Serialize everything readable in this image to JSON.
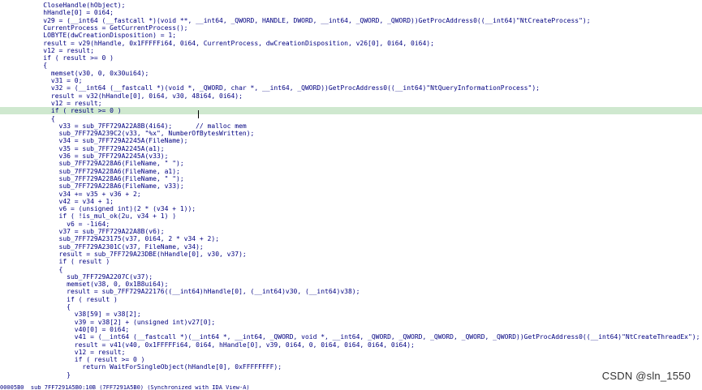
{
  "window": {
    "watermark": "CSDN @sln_1550",
    "status_text": "00005B0  sub_7FF7291A5B0:10B (7FF7291A5B0) (Synchronized with IDA View-A)"
  },
  "colors": {
    "code_text": "#000080",
    "highlight_line": "#cfe8cf",
    "comment": "#008000",
    "search_mark": "#ffff66",
    "background": "#ffffff"
  },
  "code_lines": [
    "    CloseHandle(hObject);",
    "    hHandle[0] = 0i64;",
    "    v29 = (__int64 (__fastcall *)(void **, __int64, _QWORD, HANDLE, DWORD, __int64, _QWORD, _QWORD))GetProcAddress0((__int64)\"NtCreateProcess\");",
    "    CurrentProcess = GetCurrentProcess();",
    "    LOBYTE(dwCreationDisposition) = 1;",
    "    result = v29(hHandle, 0x1FFFFFi64, 0i64, CurrentProcess, dwCreationDisposition, v26[0], 0i64, 0i64);",
    "    v12 = result;",
    "    if ( result >= 0 )",
    "    {",
    "      memset(v30, 0, 0x30ui64);",
    "      v31 = 0;",
    "      v32 = (__int64 (__fastcall *)(void *, _QWORD, char *, __int64, _QWORD))GetProcAddress0((__int64)\"NtQueryInformationProcess\");",
    "      result = v32(hHandle[0], 0i64, v30, 48i64, 0i64);",
    "      v12 = result;",
    "      if ( result >= 0 )",
    "      {",
    "        v33 = sub_7FF729A22A8B(4i64);      // malloc mem",
    "        sub_7FF729A239C2(v33, \"%x\", NumberOfBytesWritten);",
    "        v34 = sub_7FF729A2245A(FileName);",
    "        v35 = sub_7FF729A2245A(a1);",
    "        v36 = sub_7FF729A2245A(v33);",
    "        sub_7FF729A228A6(FileName, \" \");",
    "        sub_7FF729A228A6(FileName, a1);",
    "        sub_7FF729A228A6(FileName, \" \");",
    "        sub_7FF729A228A6(FileName, v33);",
    "        v34 += v35 + v36 + 2;",
    "        v42 = v34 + 1;",
    "        v6 = (unsigned int)(2 * (v34 + 1));",
    "        if ( !is_mul_ok(2u, v34 + 1) )",
    "          v6 = -1i64;",
    "        v37 = sub_7FF729A22A8B(v6);",
    "        sub_7FF729A23175(v37, 0i64, 2 * v34 + 2);",
    "        sub_7FF729A2301C(v37, FileName, v34);",
    "        result = sub_7FF729A23DBE(hHandle[0], v30, v37);",
    "        if ( result )",
    "        {",
    "          sub_7FF729A2207C(v37);",
    "          memset(v38, 0, 0x1B8ui64);",
    "          result = sub_7FF729A22176((__int64)hHandle[0], (__int64)v30, (__int64)v38);",
    "          if ( result )",
    "          {",
    "            v38[59] = v38[2];",
    "            v39 = v38[2] + (unsigned int)v27[0];",
    "            v40[0] = 0i64;",
    "            v41 = (__int64 (__fastcall *)(__int64 *, __int64, _QWORD, void *, __int64, _QWORD, _QWORD, _QWORD, _QWORD, _QWORD))GetProcAddress0((__int64)\"NtCreateThreadEx\");",
    "            result = v41(v40, 0x1FFFFFi64, 0i64, hHandle[0], v39, 0i64, 0, 0i64, 0i64, 0i64, 0i64);",
    "            v12 = result;",
    "            if ( result >= 0 )",
    "              return WaitForSingleObject(hHandle[0], 0xFFFFFFFF);",
    "          }"
  ]
}
